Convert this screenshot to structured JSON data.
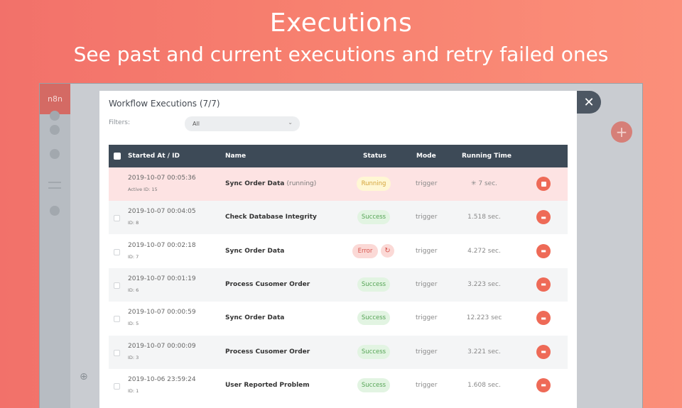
{
  "hero": {
    "title": "Executions",
    "subtitle": "See past and current executions and retry failed ones"
  },
  "app": {
    "logo_text": "n8n"
  },
  "modal": {
    "title": "Workflow Executions (7/7)",
    "filters_label": "Filters:",
    "filter_value": "All",
    "columns": [
      "Started At / ID",
      "Name",
      "Status",
      "Mode",
      "Running Time"
    ],
    "rows": [
      {
        "date": "2019-10-07 00:05:36",
        "id": "Active ID: 15",
        "name": "Sync Order Data",
        "name_extra": "(running)",
        "status": "Running",
        "mode": "trigger",
        "time": "7 sec.",
        "action": "stop"
      },
      {
        "date": "2019-10-07 00:04:05",
        "id": "ID: 8",
        "name": "Check Database Integrity",
        "name_extra": "",
        "status": "Success",
        "mode": "trigger",
        "time": "1.518 sec.",
        "action": "open"
      },
      {
        "date": "2019-10-07 00:02:18",
        "id": "ID: 7",
        "name": "Sync Order Data",
        "name_extra": "",
        "status": "Error",
        "mode": "trigger",
        "time": "4.272 sec.",
        "action": "open"
      },
      {
        "date": "2019-10-07 00:01:19",
        "id": "ID: 6",
        "name": "Process Cusomer Order",
        "name_extra": "",
        "status": "Success",
        "mode": "trigger",
        "time": "3.223 sec.",
        "action": "open"
      },
      {
        "date": "2019-10-07 00:00:59",
        "id": "ID: 5",
        "name": "Sync Order Data",
        "name_extra": "",
        "status": "Success",
        "mode": "trigger",
        "time": "12.223 sec",
        "action": "open"
      },
      {
        "date": "2019-10-07 00:00:09",
        "id": "ID: 3",
        "name": "Process Cusomer Order",
        "name_extra": "",
        "status": "Success",
        "mode": "trigger",
        "time": "3.221 sec.",
        "action": "open"
      },
      {
        "date": "2019-10-06 23:59:24",
        "id": "ID: 1",
        "name": "User Reported Problem",
        "name_extra": "",
        "status": "Success",
        "mode": "trigger",
        "time": "1.608 sec.",
        "action": "open"
      }
    ]
  },
  "icons": {
    "close": "close-icon",
    "retry": "retry-icon",
    "open": "folder-open-icon",
    "stop": "stop-icon",
    "spinner": "spinner-icon"
  },
  "colors": {
    "background": "#f2716a",
    "header": "#3d4a57",
    "action": "#ee6a57",
    "success": "#56a456",
    "error": "#d6534b",
    "running": "#d4a33a"
  }
}
